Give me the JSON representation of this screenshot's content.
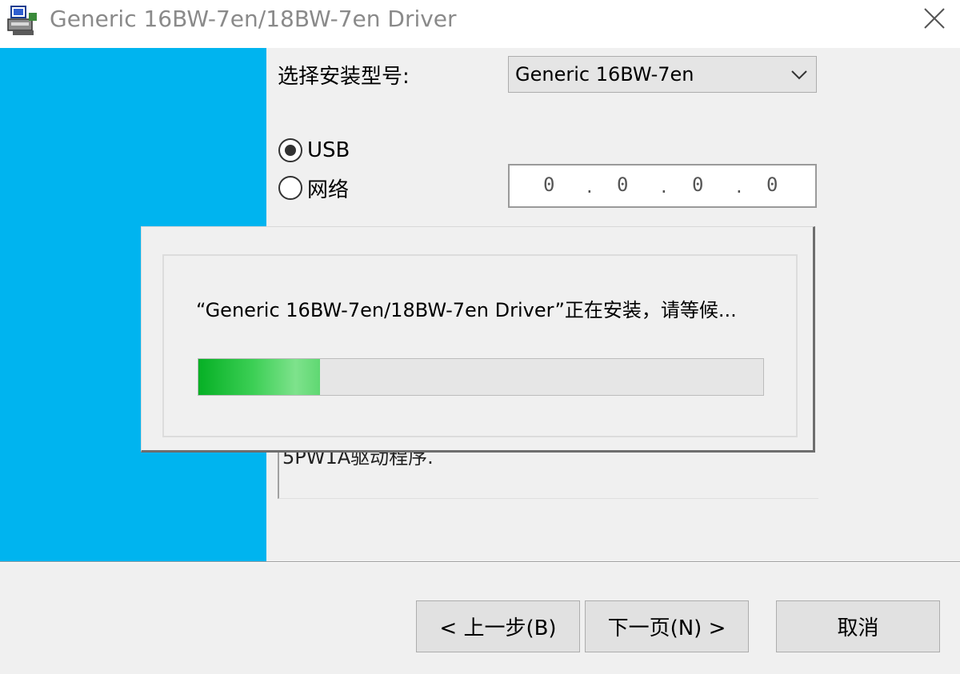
{
  "window": {
    "title": "Generic 16BW-7en/18BW-7en Driver",
    "icons": {
      "app": "printer-installer-icon",
      "close": "close-icon"
    }
  },
  "form": {
    "model_label": "选择安装型号:",
    "model_select": {
      "value": "Generic 16BW-7en"
    },
    "connection": {
      "usb_label": "USB",
      "network_label": "网络",
      "selected": "USB"
    },
    "ip_address": {
      "seg1": "0",
      "seg2": "0",
      "seg3": "0",
      "seg4": "0",
      "sep": "."
    },
    "description_partial": "5PW1A驱动程序."
  },
  "progress_dialog": {
    "message": "“Generic 16BW-7en/18BW-7en Driver”正在安装，请等候...",
    "progress_fraction": 0.215
  },
  "buttons": {
    "back": "< 上一步(B)",
    "next": "下一页(N) >",
    "cancel": "取消"
  },
  "colors": {
    "banner": "#00b4ef",
    "progress": "#06b025"
  }
}
